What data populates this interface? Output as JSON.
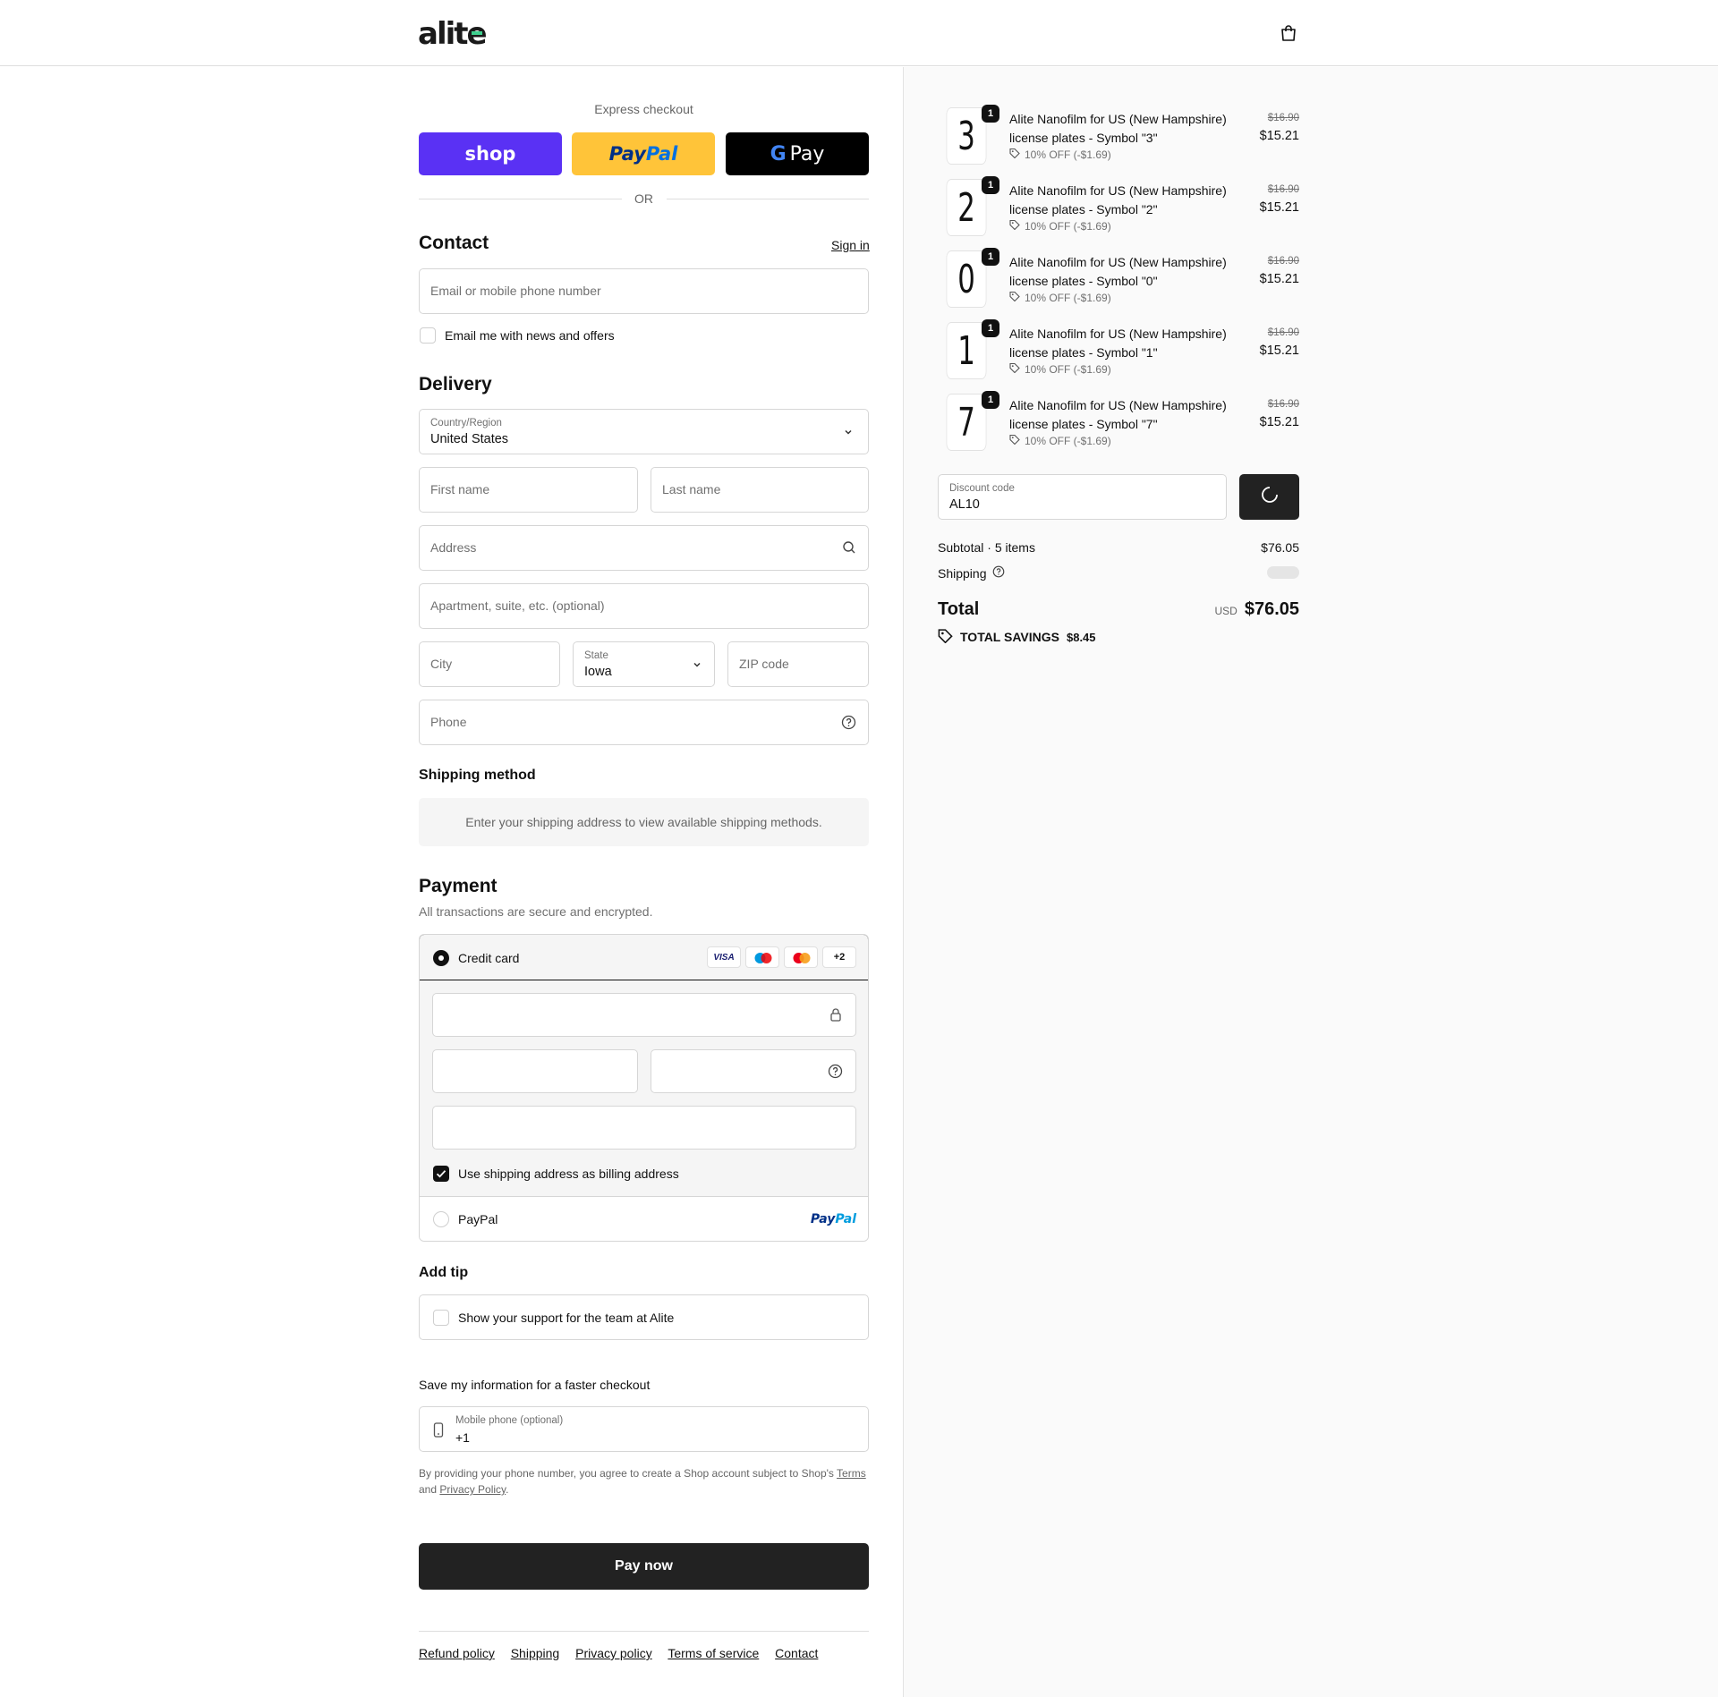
{
  "header": {
    "brand": "alite",
    "brand_accent": "#3ecf8e"
  },
  "express": {
    "title": "Express checkout",
    "shop_label": "shop",
    "paypal_label_1": "Pay",
    "paypal_label_2": "Pal",
    "gpay_label": "Pay",
    "or_label": "OR",
    "colors": {
      "shop": "#5a31f4",
      "paypal": "#ffc439",
      "gpay": "#000000"
    }
  },
  "contact": {
    "title": "Contact",
    "signin": "Sign in",
    "email_placeholder": "Email or mobile phone number",
    "news_label": "Email me with news and offers"
  },
  "delivery": {
    "title": "Delivery",
    "country_label": "Country/Region",
    "country_value": "United States",
    "first_name": "First name",
    "last_name": "Last name",
    "address": "Address",
    "apartment": "Apartment, suite, etc. (optional)",
    "city": "City",
    "state_label": "State",
    "state_value": "Iowa",
    "zip": "ZIP code",
    "phone": "Phone"
  },
  "shipping_method": {
    "title": "Shipping method",
    "message": "Enter your shipping address to view available shipping methods."
  },
  "payment": {
    "title": "Payment",
    "subtitle": "All transactions are secure and encrypted.",
    "credit_card": "Credit card",
    "visa": "VISA",
    "more_cards": "+2",
    "billing_label": "Use shipping address as billing address",
    "paypal": "PayPal",
    "paypal_logo_1": "Pay",
    "paypal_logo_2": "Pal"
  },
  "tip": {
    "title": "Add tip",
    "label": "Show your support for the team at Alite"
  },
  "save_info": {
    "title": "Save my information for a faster checkout",
    "phone_label": "Mobile phone (optional)",
    "phone_value": "+1",
    "legal_1": "By providing your phone number, you agree to create a Shop account subject to Shop's",
    "terms": "Terms",
    "legal_2": "and",
    "privacy": "Privacy Policy",
    "legal_3": "."
  },
  "pay_button": "Pay now",
  "footer": [
    "Refund policy",
    "Shipping",
    "Privacy policy",
    "Terms of service",
    "Contact"
  ],
  "items": [
    {
      "symbol": "3",
      "qty": "1",
      "name": "Alite Nanofilm for US (New Hampshire) license plates - Symbol \"3\"",
      "discount": "10% OFF (-$1.69)",
      "old_price": "$16.90",
      "price": "$15.21"
    },
    {
      "symbol": "2",
      "qty": "1",
      "name": "Alite Nanofilm for US (New Hampshire) license plates - Symbol \"2\"",
      "discount": "10% OFF (-$1.69)",
      "old_price": "$16.90",
      "price": "$15.21"
    },
    {
      "symbol": "0",
      "qty": "1",
      "name": "Alite Nanofilm for US (New Hampshire) license plates - Symbol \"0\"",
      "discount": "10% OFF (-$1.69)",
      "old_price": "$16.90",
      "price": "$15.21"
    },
    {
      "symbol": "1",
      "qty": "1",
      "name": "Alite Nanofilm for US (New Hampshire) license plates - Symbol \"1\"",
      "discount": "10% OFF (-$1.69)",
      "old_price": "$16.90",
      "price": "$15.21"
    },
    {
      "symbol": "7",
      "qty": "1",
      "name": "Alite Nanofilm for US (New Hampshire) license plates - Symbol \"7\"",
      "discount": "10% OFF (-$1.69)",
      "old_price": "$16.90",
      "price": "$15.21"
    }
  ],
  "discount": {
    "label": "Discount code",
    "value": "AL10"
  },
  "totals": {
    "subtotal_label": "Subtotal · 5 items",
    "subtotal_value": "$76.05",
    "shipping_label": "Shipping",
    "total_label": "Total",
    "currency": "USD",
    "total_value": "$76.05",
    "savings_label": "TOTAL SAVINGS",
    "savings_value": "$8.45"
  }
}
